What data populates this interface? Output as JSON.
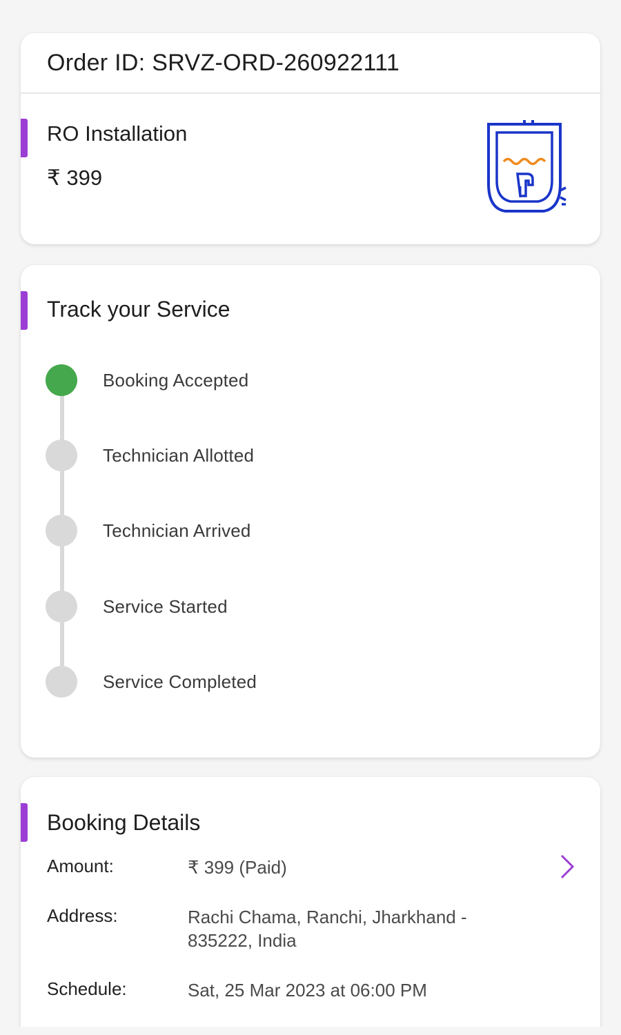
{
  "order": {
    "order_id_text": "Order ID: SRVZ-ORD-260922111",
    "service_name": "RO Installation",
    "service_price": "₹ 399",
    "service_icon": "ro-purifier-icon"
  },
  "tracking": {
    "heading": "Track your Service",
    "steps": [
      {
        "label": "Booking Accepted",
        "status": "done"
      },
      {
        "label": "Technician Allotted",
        "status": "pending"
      },
      {
        "label": "Technician Arrived",
        "status": "pending"
      },
      {
        "label": "Service Started",
        "status": "pending"
      },
      {
        "label": "Service Completed",
        "status": "pending"
      }
    ]
  },
  "booking": {
    "heading": "Booking Details",
    "amount_label": "Amount:",
    "amount_value": "₹ 399 (Paid)",
    "address_label": "Address:",
    "address_value": "Rachi Chama, Ranchi, Jharkhand - 835222, India",
    "schedule_label": "Schedule:",
    "schedule_value": "Sat, 25 Mar 2023 at 06:00 PM"
  },
  "colors": {
    "accent": "#9b3fd4",
    "done": "#46a84c",
    "pending": "#d9d9d9",
    "icon_blue": "#1a35c9",
    "icon_orange": "#f08a1c"
  }
}
